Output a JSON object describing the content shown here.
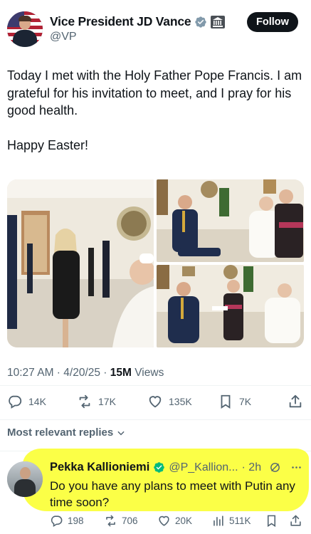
{
  "post": {
    "author_name": "Vice President JD Vance",
    "author_handle": "@VP",
    "follow_label": "Follow",
    "text": "Today I met with the Holy Father Pope Francis. I am grateful for his invitation to meet, and I pray for his good health.\n\nHappy Easter!",
    "time": "10:27 AM",
    "date": "4/20/25",
    "views_count": "15M",
    "views_label": "Views",
    "separator": " · "
  },
  "actions": {
    "replies": "14K",
    "reposts": "17K",
    "likes": "135K",
    "bookmarks": "7K"
  },
  "icons": [
    "verified-badge-icon",
    "government-building-icon",
    "reply-icon",
    "repost-icon",
    "like-icon",
    "bookmark-icon",
    "share-icon",
    "chevron-down-icon",
    "grok-icon",
    "more-icon",
    "views-icon"
  ],
  "colors": {
    "verified_badge": "#829aab",
    "reply_verified_badge": "#00ba7c",
    "highlight": "#fbff33"
  },
  "replies_sort": {
    "label": "Most relevant replies"
  },
  "reply": {
    "author_name": "Pekka Kallionieminen",
    "author_name_display": "Pekka Kallioniemi",
    "author_handle": "@P_Kallion...",
    "time": "· 2h",
    "text": "Do you have any plans to meet with Putin any time soon?",
    "replies": "198",
    "reposts": "706",
    "likes": "20K",
    "views": "511K"
  }
}
